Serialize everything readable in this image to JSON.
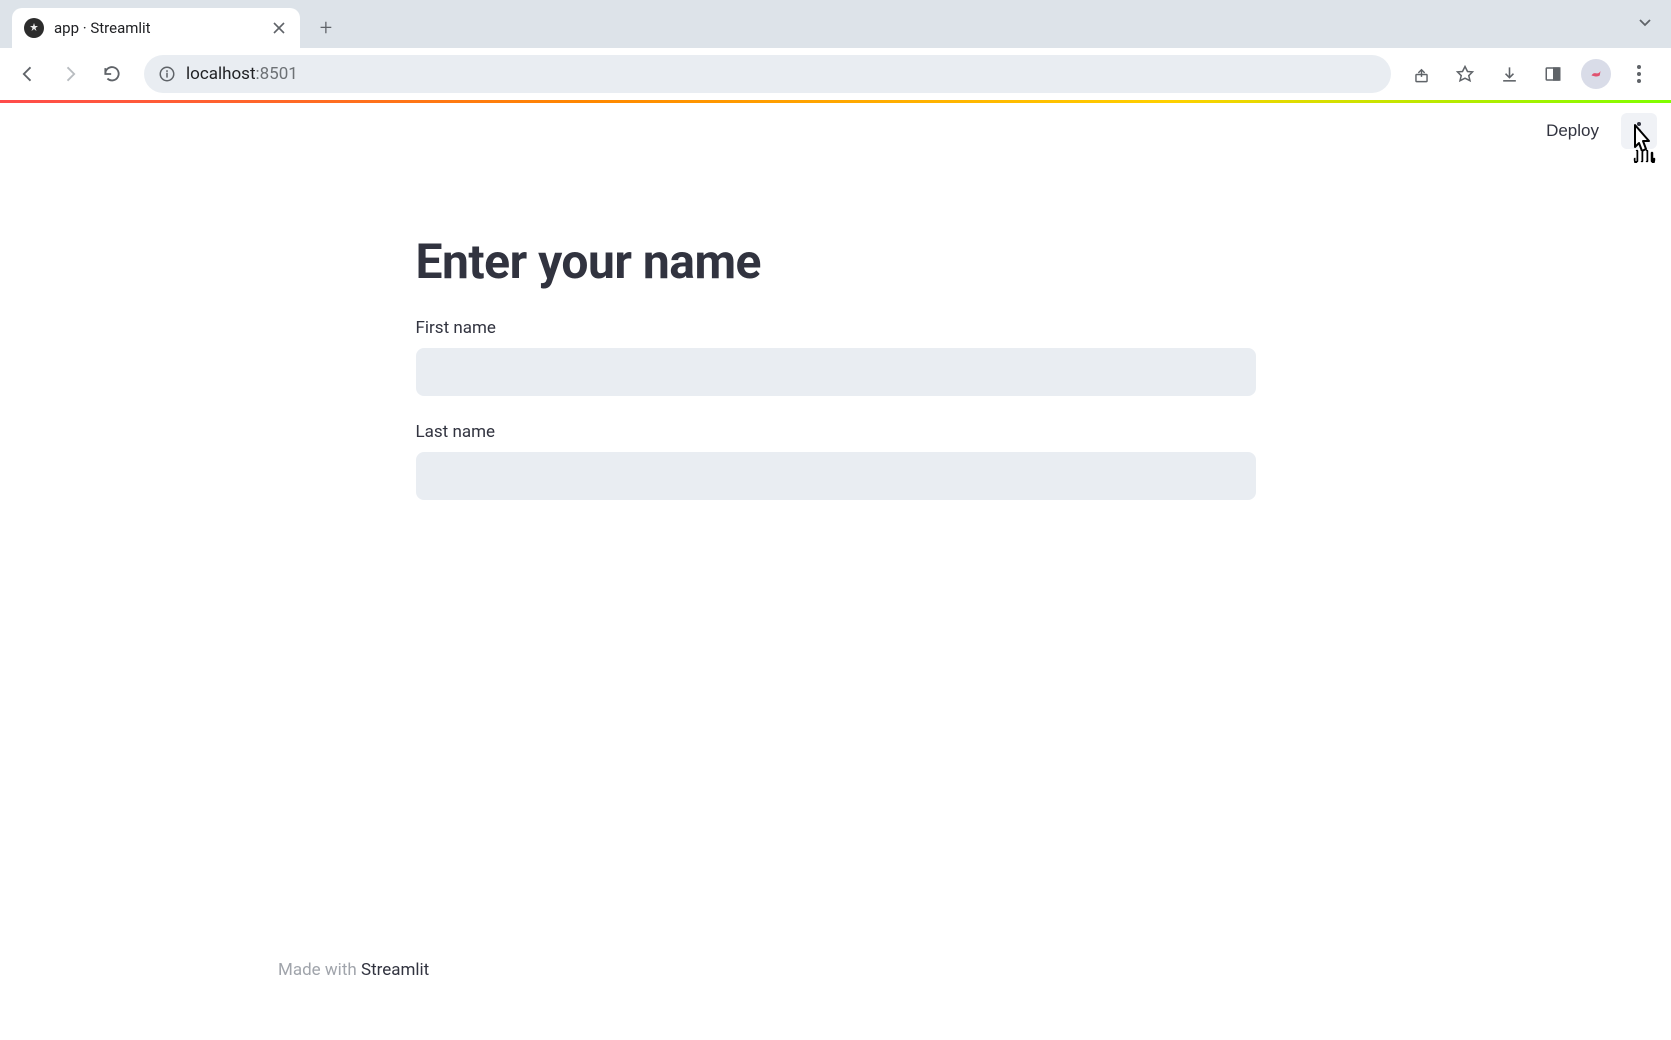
{
  "browser": {
    "tab_title": "app · Streamlit",
    "url_host": "localhost",
    "url_port": ":8501"
  },
  "app": {
    "header": {
      "deploy_label": "Deploy"
    },
    "content": {
      "title": "Enter your name",
      "fields": [
        {
          "label": "First name",
          "value": ""
        },
        {
          "label": "Last name",
          "value": ""
        }
      ]
    },
    "footer": {
      "made_with": "Made with ",
      "brand": "Streamlit"
    }
  }
}
